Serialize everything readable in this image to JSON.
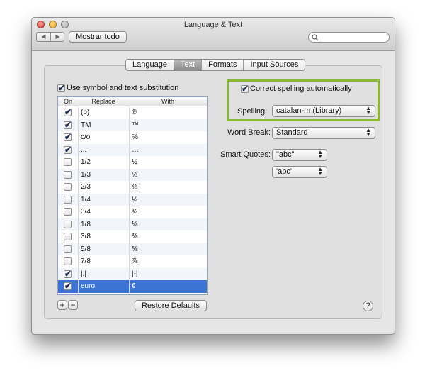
{
  "window": {
    "title": "Language & Text"
  },
  "toolbar": {
    "show_all_label": "Mostrar todo",
    "back_glyph": "◀",
    "forward_glyph": "▶",
    "search_placeholder": ""
  },
  "tabs": [
    {
      "label": "Language",
      "active": false
    },
    {
      "label": "Text",
      "active": true
    },
    {
      "label": "Formats",
      "active": false
    },
    {
      "label": "Input Sources",
      "active": false
    }
  ],
  "substitution": {
    "checkbox_label": "Use symbol and text substitution",
    "checked": true,
    "columns": {
      "on": "On",
      "replace": "Replace",
      "with": "With"
    },
    "rows": [
      {
        "on": true,
        "replace": "(p)",
        "with": "℗"
      },
      {
        "on": true,
        "replace": "TM",
        "with": "™"
      },
      {
        "on": true,
        "replace": "c/o",
        "with": "℅"
      },
      {
        "on": true,
        "replace": "...",
        "with": "…"
      },
      {
        "on": false,
        "replace": "1/2",
        "with": "½"
      },
      {
        "on": false,
        "replace": "1/3",
        "with": "⅓"
      },
      {
        "on": false,
        "replace": "2/3",
        "with": "⅔"
      },
      {
        "on": false,
        "replace": "1/4",
        "with": "¼"
      },
      {
        "on": false,
        "replace": "3/4",
        "with": "¾"
      },
      {
        "on": false,
        "replace": "1/8",
        "with": "⅛"
      },
      {
        "on": false,
        "replace": "3/8",
        "with": "⅜"
      },
      {
        "on": false,
        "replace": "5/8",
        "with": "⅝"
      },
      {
        "on": false,
        "replace": "7/8",
        "with": "⅞"
      },
      {
        "on": true,
        "replace": "|.|",
        "with": "|-|"
      },
      {
        "on": true,
        "replace": "euro",
        "with": "€",
        "selected": true
      }
    ],
    "add_label": "+",
    "remove_label": "−",
    "restore_label": "Restore Defaults"
  },
  "spelling": {
    "correct_label": "Correct spelling automatically",
    "correct_checked": true,
    "spelling_label": "Spelling:",
    "spelling_value": "catalan-m (Library)",
    "highlight_color": "#8ab734"
  },
  "word_break": {
    "label": "Word Break:",
    "value": "Standard"
  },
  "smart_quotes": {
    "label": "Smart Quotes:",
    "double_value": "\"abc\"",
    "single_value": "'abc'"
  },
  "help": {
    "label": "?"
  },
  "icons": {
    "check": "✔",
    "search": "magnifier-icon",
    "updown": "up-down-arrows-icon"
  },
  "colors": {
    "selection": "#3d74d4",
    "accent_green": "#8ab734"
  }
}
